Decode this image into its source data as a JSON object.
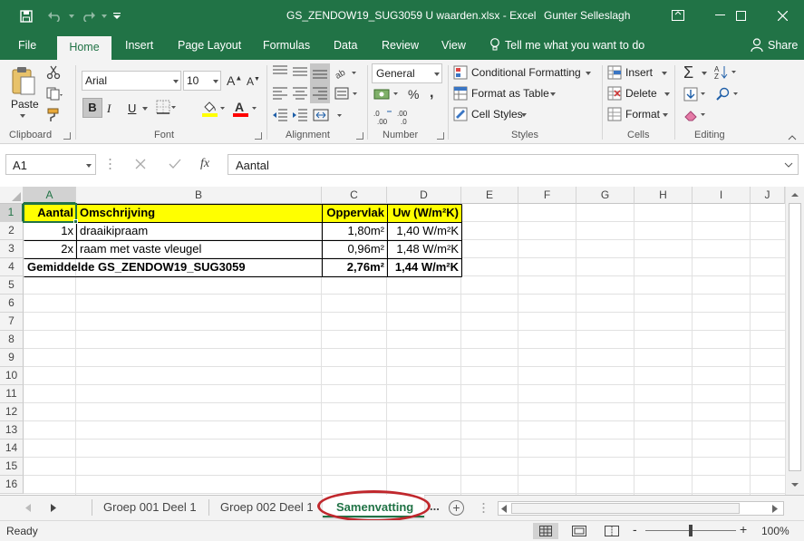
{
  "window": {
    "title": "GS_ZENDOW19_SUG3059 U waarden.xlsx  -  Excel",
    "user": "Gunter Selleslagh"
  },
  "menu": {
    "tabs": [
      "File",
      "Home",
      "Insert",
      "Page Layout",
      "Formulas",
      "Data",
      "Review",
      "View"
    ],
    "active": "Home",
    "tell_me": "Tell me what you want to do",
    "share": "Share"
  },
  "ribbon": {
    "clipboard": {
      "label": "Clipboard",
      "paste": "Paste"
    },
    "font": {
      "label": "Font",
      "name": "Arial",
      "size": "10",
      "bold": "B",
      "italic": "I",
      "underline": "U"
    },
    "alignment": {
      "label": "Alignment"
    },
    "number": {
      "label": "Number",
      "format": "General"
    },
    "styles": {
      "label": "Styles",
      "conditional": "Conditional Formatting",
      "table": "Format as Table",
      "cell_styles": "Cell Styles"
    },
    "cells": {
      "label": "Cells",
      "insert": "Insert",
      "delete": "Delete",
      "format": "Format"
    },
    "editing": {
      "label": "Editing"
    },
    "colors": {
      "fill": "#ffff00",
      "font_color": "#ff0000"
    }
  },
  "formula_bar": {
    "name_box": "A1",
    "fx": "fx",
    "content": "Aantal"
  },
  "grid": {
    "columns": [
      "A",
      "B",
      "C",
      "D",
      "E",
      "F",
      "G",
      "H",
      "I",
      "J"
    ],
    "rows": [
      "1",
      "2",
      "3",
      "4",
      "5",
      "6",
      "7",
      "8",
      "9",
      "10",
      "11",
      "12",
      "13",
      "14",
      "15",
      "16"
    ],
    "header_row": {
      "a": "Aantal",
      "b": "Omschrijving",
      "c": "Oppervlak",
      "d": "Uw (W/m²K)"
    },
    "data_rows": [
      {
        "a": "1x",
        "b": "draaikipraam",
        "c": "1,80m²",
        "d": "1,40 W/m²K"
      },
      {
        "a": "2x",
        "b": "raam met vaste vleugel",
        "c": "0,96m²",
        "d": "1,48 W/m²K"
      }
    ],
    "total_row": {
      "label": "Gemiddelde GS_ZENDOW19_SUG3059",
      "c": "2,76m²",
      "d": "1,44 W/m²K"
    },
    "header_fill": "#ffff00"
  },
  "sheets": {
    "tabs": [
      "Groep 001 Deel 1",
      "Groep 002 Deel 1",
      "Samenvatting"
    ],
    "active": "Samenvatting",
    "more": "...",
    "highlight_color": "#c0282d"
  },
  "status": {
    "text": "Ready",
    "zoom": "100%",
    "zoom_minus": "-",
    "zoom_plus": "+"
  }
}
